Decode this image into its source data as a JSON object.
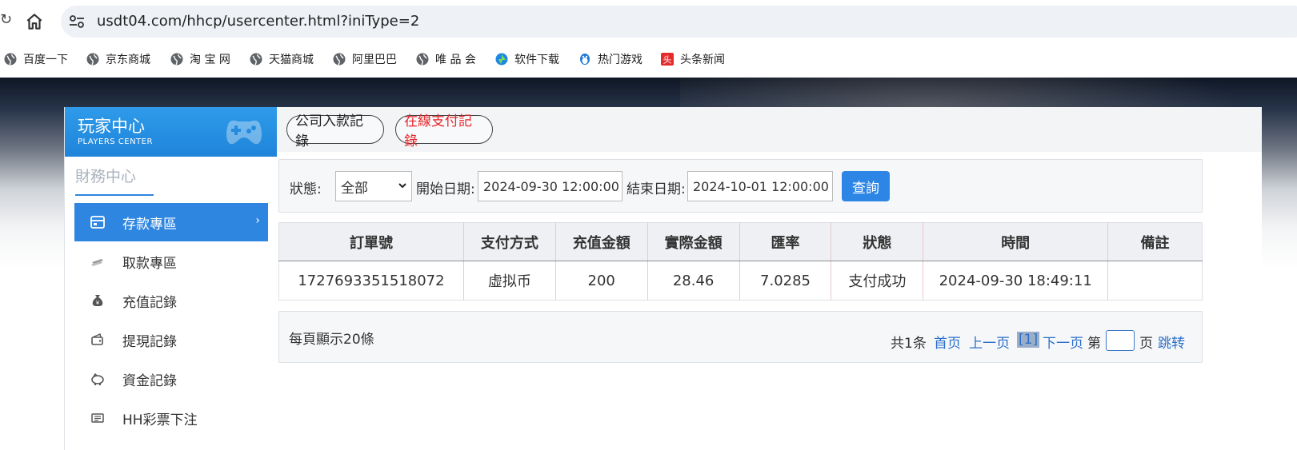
{
  "browser": {
    "reload_glyph": "↻",
    "url": "usdt04.com/hhcp/usercenter.html?iniType=2"
  },
  "bookmarks": [
    {
      "label": "百度一下",
      "icon": "globe-icon"
    },
    {
      "label": "京东商城",
      "icon": "globe-icon"
    },
    {
      "label": "淘 宝 网",
      "icon": "globe-icon"
    },
    {
      "label": "天猫商城",
      "icon": "globe-icon"
    },
    {
      "label": "阿里巴巴",
      "icon": "globe-icon"
    },
    {
      "label": "唯 品 会",
      "icon": "globe-icon"
    },
    {
      "label": "软件下载",
      "icon": "download-icon"
    },
    {
      "label": "热门游戏",
      "icon": "penguin-icon"
    },
    {
      "label": "头条新闻",
      "icon": "toutiao-icon"
    }
  ],
  "sidebar": {
    "title": "玩家中心",
    "subtitle": "PLAYERS CENTER",
    "section": "財務中心",
    "items": [
      {
        "label": "存款專區",
        "icon": "card-icon",
        "active": true
      },
      {
        "label": "取款專區",
        "icon": "cash-icon",
        "active": false
      },
      {
        "label": "充值記錄",
        "icon": "moneybag-icon",
        "active": false
      },
      {
        "label": "提現記錄",
        "icon": "wallet-icon",
        "active": false
      },
      {
        "label": "資金記錄",
        "icon": "piggybank-icon",
        "active": false
      },
      {
        "label": "HH彩票下注",
        "icon": "ticket-icon",
        "active": false
      }
    ],
    "arrow": "›"
  },
  "tabs": [
    {
      "label": "公司入款記錄",
      "color": "#222222"
    },
    {
      "label": "在線支付記錄",
      "color": "#e8252b"
    }
  ],
  "filter": {
    "status_label": "狀態:",
    "status_value": "全部",
    "start_label": "開始日期:",
    "start_value": "2024-09-30 12:00:00",
    "end_label": "結束日期:",
    "end_value": "2024-10-01 12:00:00",
    "query_button": "查詢"
  },
  "table": {
    "headers": [
      "訂單號",
      "支付方式",
      "充值金額",
      "實際金額",
      "匯率",
      "狀態",
      "時間",
      "備註"
    ],
    "rows": [
      [
        "1727693351518072",
        "虛拟币",
        "200",
        "28.46",
        "7.0285",
        "支付成功",
        "2024-09-30 18:49:11",
        ""
      ]
    ]
  },
  "pager": {
    "per_page": "每頁顯示20條",
    "total": "共1条",
    "first": "首页",
    "prev": "上一页",
    "current": "[1]",
    "next": "下一页",
    "page_prefix": "第",
    "page_suffix": "页",
    "jump": "跳转"
  },
  "colors": {
    "accent": "#2f86e0",
    "link": "#2b6fc9",
    "online_tab_text": "#e8252b"
  }
}
